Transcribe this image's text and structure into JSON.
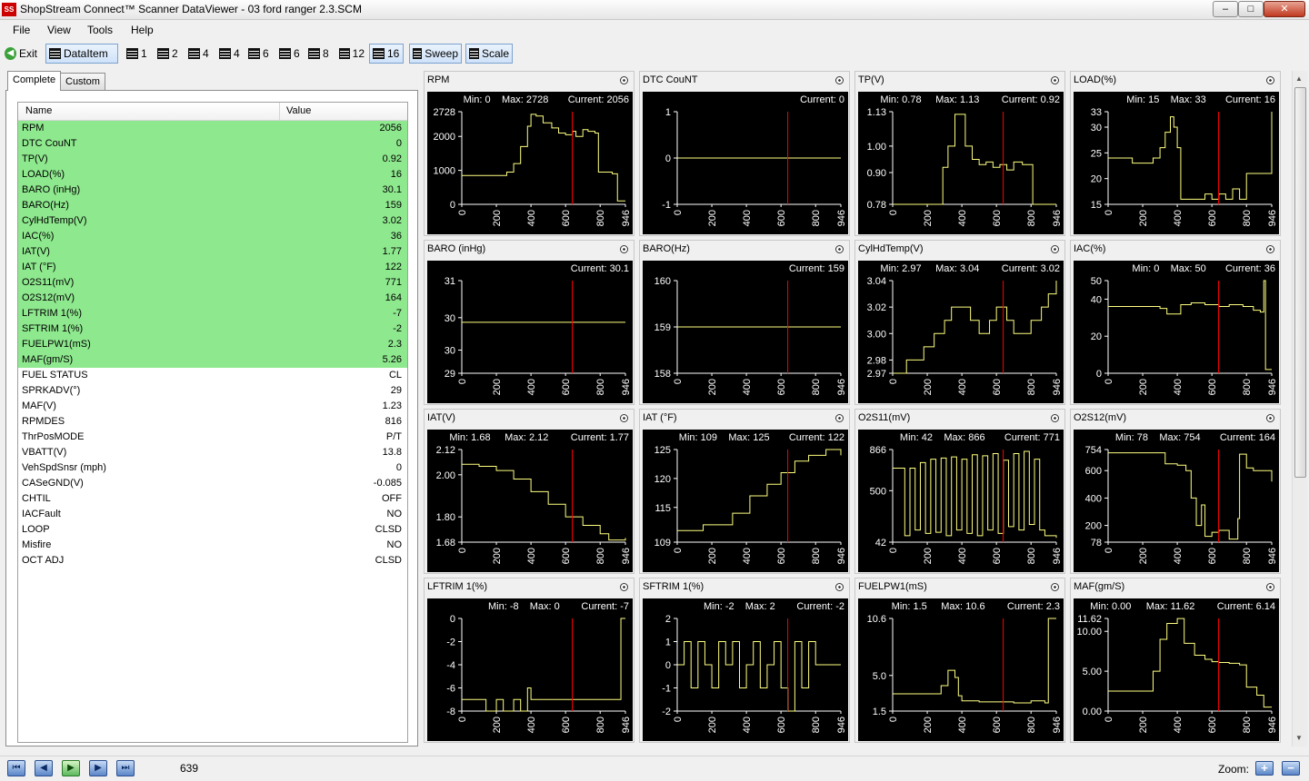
{
  "window": {
    "title": "ShopStream Connect™ Scanner DataViewer - 03 ford ranger 2.3.SCM",
    "icon_text": "SS",
    "minimize": "–",
    "maximize": "□",
    "close": "✕"
  },
  "menu": [
    "File",
    "View",
    "Tools",
    "Help"
  ],
  "toolbar": [
    {
      "id": "exit",
      "label": "Exit"
    },
    {
      "id": "dataitem",
      "label": "DataItem",
      "pressed": true
    },
    {
      "id": "layout-1",
      "label": "1"
    },
    {
      "id": "layout-2",
      "label": "2"
    },
    {
      "id": "layout-4a",
      "label": "4"
    },
    {
      "id": "layout-4b",
      "label": "4"
    },
    {
      "id": "layout-6a",
      "label": "6"
    },
    {
      "id": "layout-6b",
      "label": "6"
    },
    {
      "id": "layout-8",
      "label": "8"
    },
    {
      "id": "layout-12",
      "label": "12"
    },
    {
      "id": "layout-16",
      "label": "16",
      "pressed": true
    },
    {
      "id": "sweep",
      "label": "Sweep",
      "pressed": true
    },
    {
      "id": "scale",
      "label": "Scale",
      "pressed": true
    }
  ],
  "tabs": [
    "Complete",
    "Custom"
  ],
  "grid": {
    "headers": [
      "Name",
      "Value"
    ],
    "rows": [
      {
        "name": "RPM",
        "value": "2056",
        "hi": true
      },
      {
        "name": "DTC CouNT",
        "value": "0",
        "hi": true
      },
      {
        "name": "TP(V)",
        "value": "0.92",
        "hi": true
      },
      {
        "name": "LOAD(%)",
        "value": "16",
        "hi": true
      },
      {
        "name": "BARO (inHg)",
        "value": "30.1",
        "hi": true
      },
      {
        "name": "BARO(Hz)",
        "value": "159",
        "hi": true
      },
      {
        "name": "CylHdTemp(V)",
        "value": "3.02",
        "hi": true
      },
      {
        "name": "IAC(%)",
        "value": "36",
        "hi": true
      },
      {
        "name": "IAT(V)",
        "value": "1.77",
        "hi": true
      },
      {
        "name": "IAT (°F)",
        "value": "122",
        "hi": true
      },
      {
        "name": "O2S11(mV)",
        "value": "771",
        "hi": true
      },
      {
        "name": "O2S12(mV)",
        "value": "164",
        "hi": true
      },
      {
        "name": "LFTRIM 1(%)",
        "value": "-7",
        "hi": true
      },
      {
        "name": "SFTRIM 1(%)",
        "value": "-2",
        "hi": true
      },
      {
        "name": "FUELPW1(mS)",
        "value": "2.3",
        "hi": true
      },
      {
        "name": "MAF(gm/S)",
        "value": "5.26",
        "hi": true
      },
      {
        "name": "FUEL STATUS",
        "value": "CL",
        "hi": false
      },
      {
        "name": "SPRKADV(°)",
        "value": "29",
        "hi": false
      },
      {
        "name": "MAF(V)",
        "value": "1.23",
        "hi": false
      },
      {
        "name": "RPMDES",
        "value": "816",
        "hi": false
      },
      {
        "name": "ThrPosMODE",
        "value": "P/T",
        "hi": false
      },
      {
        "name": "VBATT(V)",
        "value": "13.8",
        "hi": false
      },
      {
        "name": "VehSpdSnsr (mph)",
        "value": "0",
        "hi": false
      },
      {
        "name": "CASeGND(V)",
        "value": "-0.085",
        "hi": false
      },
      {
        "name": "CHTIL",
        "value": "OFF",
        "hi": false
      },
      {
        "name": "IACFault",
        "value": "NO",
        "hi": false
      },
      {
        "name": "LOOP",
        "value": "CLSD",
        "hi": false
      },
      {
        "name": "Misfire",
        "value": "NO",
        "hi": false
      },
      {
        "name": "OCT ADJ",
        "value": "CLSD",
        "hi": false
      }
    ]
  },
  "status": {
    "position": "639",
    "zoom_label": "Zoom:",
    "nav": [
      "⏮",
      "◀",
      "▶",
      "▶",
      "⏭"
    ],
    "zoom_in": "+",
    "zoom_out": "−"
  },
  "chart_colors": {
    "bg": "#000000",
    "line": "#ffff80",
    "cursor": "#ff0000",
    "axis": "#ffffff"
  },
  "chart_data": [
    {
      "type": "line",
      "title": "RPM",
      "min": "0",
      "max": "2728",
      "current": "2056",
      "ylim": [
        0,
        2728
      ],
      "yticks": [
        "2728",
        "2000",
        "1000",
        "0"
      ],
      "ytickvals": [
        2728,
        2000,
        1000,
        0
      ],
      "xticks": [
        "0",
        "200",
        "400",
        "600",
        "800",
        "946"
      ],
      "xlim": [
        0,
        946
      ],
      "cursor": 639,
      "x": [
        0,
        250,
        260,
        300,
        340,
        380,
        400,
        430,
        470,
        520,
        560,
        600,
        640,
        660,
        700,
        730,
        770,
        790,
        840,
        870,
        900,
        946
      ],
      "y": [
        850,
        850,
        950,
        1200,
        1700,
        2300,
        2650,
        2600,
        2400,
        2250,
        2100,
        2050,
        2150,
        2000,
        2200,
        2150,
        2100,
        950,
        950,
        900,
        100,
        100
      ]
    },
    {
      "type": "line",
      "title": "DTC CouNT",
      "current": "0",
      "ylim": [
        -1,
        1
      ],
      "yticks": [
        "1",
        "0",
        "-1"
      ],
      "ytickvals": [
        1,
        0,
        -1
      ],
      "xticks": [
        "0",
        "200",
        "400",
        "600",
        "800",
        "946"
      ],
      "xlim": [
        0,
        946
      ],
      "cursor": 639,
      "x": [
        0,
        946
      ],
      "y": [
        0,
        0
      ]
    },
    {
      "type": "line",
      "title": "TP(V)",
      "min": "0.78",
      "max": "1.13",
      "current": "0.92",
      "ylim": [
        0.78,
        1.13
      ],
      "yticks": [
        "1.13",
        "1.00",
        "0.90",
        "0.78"
      ],
      "ytickvals": [
        1.13,
        1.0,
        0.9,
        0.78
      ],
      "xticks": [
        "0",
        "200",
        "400",
        "600",
        "800",
        "946"
      ],
      "xlim": [
        0,
        946
      ],
      "cursor": 639,
      "x": [
        0,
        270,
        290,
        320,
        360,
        420,
        460,
        500,
        540,
        580,
        620,
        660,
        700,
        750,
        800,
        810,
        946
      ],
      "y": [
        0.78,
        0.78,
        0.92,
        1.0,
        1.12,
        1.0,
        0.95,
        0.93,
        0.94,
        0.92,
        0.93,
        0.91,
        0.94,
        0.93,
        0.93,
        0.78,
        0.78
      ]
    },
    {
      "type": "line",
      "title": "LOAD(%)",
      "min": "15",
      "max": "33",
      "current": "16",
      "ylim": [
        15,
        33
      ],
      "yticks": [
        "33",
        "30",
        "25",
        "20",
        "15"
      ],
      "ytickvals": [
        33,
        30,
        25,
        20,
        15
      ],
      "xticks": [
        "0",
        "200",
        "400",
        "600",
        "800",
        "946"
      ],
      "xlim": [
        0,
        946
      ],
      "cursor": 639,
      "x": [
        0,
        100,
        140,
        220,
        260,
        300,
        330,
        360,
        380,
        400,
        420,
        500,
        560,
        600,
        640,
        680,
        720,
        760,
        800,
        880,
        946
      ],
      "y": [
        24,
        24,
        23,
        23,
        24,
        26,
        29,
        32,
        30,
        26,
        16,
        16,
        17,
        16,
        17,
        16,
        18,
        16,
        21,
        21,
        33
      ]
    },
    {
      "type": "line",
      "title": "BARO (inHg)",
      "current": "30.1",
      "ylim": [
        29,
        31
      ],
      "yticks": [
        "31",
        "30",
        "30",
        "29"
      ],
      "ytickvals": [
        31,
        30.2,
        29.5,
        29
      ],
      "xticks": [
        "0",
        "200",
        "400",
        "600",
        "800",
        "946"
      ],
      "xlim": [
        0,
        946
      ],
      "cursor": 639,
      "x": [
        0,
        946
      ],
      "y": [
        30.1,
        30.1
      ]
    },
    {
      "type": "line",
      "title": "BARO(Hz)",
      "current": "159",
      "ylim": [
        158,
        160
      ],
      "yticks": [
        "160",
        "159",
        "158"
      ],
      "ytickvals": [
        160,
        159,
        158
      ],
      "xticks": [
        "0",
        "200",
        "400",
        "600",
        "800",
        "946"
      ],
      "xlim": [
        0,
        946
      ],
      "cursor": 639,
      "x": [
        0,
        946
      ],
      "y": [
        159,
        159
      ]
    },
    {
      "type": "line",
      "title": "CylHdTemp(V)",
      "min": "2.97",
      "max": "3.04",
      "current": "3.02",
      "ylim": [
        2.97,
        3.04
      ],
      "yticks": [
        "3.04",
        "3.02",
        "3.00",
        "2.98",
        "2.97"
      ],
      "ytickvals": [
        3.04,
        3.02,
        3.0,
        2.98,
        2.97
      ],
      "xticks": [
        "0",
        "200",
        "400",
        "600",
        "800",
        "946"
      ],
      "xlim": [
        0,
        946
      ],
      "cursor": 639,
      "x": [
        0,
        80,
        180,
        240,
        300,
        340,
        400,
        450,
        500,
        560,
        600,
        660,
        700,
        760,
        800,
        860,
        900,
        946
      ],
      "y": [
        2.97,
        2.98,
        2.99,
        3.0,
        3.01,
        3.02,
        3.02,
        3.01,
        3.0,
        3.01,
        3.02,
        3.01,
        3.0,
        3.0,
        3.01,
        3.02,
        3.03,
        3.04
      ]
    },
    {
      "type": "line",
      "title": "IAC(%)",
      "min": "0",
      "max": "50",
      "current": "36",
      "ylim": [
        0,
        50
      ],
      "yticks": [
        "50",
        "40",
        "20",
        "0"
      ],
      "ytickvals": [
        50,
        40,
        20,
        0
      ],
      "xticks": [
        "0",
        "200",
        "400",
        "600",
        "800",
        "946"
      ],
      "xlim": [
        0,
        946
      ],
      "cursor": 639,
      "x": [
        0,
        200,
        300,
        340,
        420,
        480,
        560,
        640,
        700,
        780,
        840,
        880,
        900,
        910,
        946
      ],
      "y": [
        36,
        36,
        35,
        32,
        37,
        38,
        37,
        36,
        37,
        36,
        34,
        33,
        50,
        2,
        2
      ]
    },
    {
      "type": "line",
      "title": "IAT(V)",
      "min": "1.68",
      "max": "2.12",
      "current": "1.77",
      "ylim": [
        1.68,
        2.12
      ],
      "yticks": [
        "2.12",
        "2.00",
        "1.80",
        "1.68"
      ],
      "ytickvals": [
        2.12,
        2.0,
        1.8,
        1.68
      ],
      "xticks": [
        "0",
        "200",
        "400",
        "600",
        "800",
        "946"
      ],
      "xlim": [
        0,
        946
      ],
      "cursor": 639,
      "x": [
        0,
        100,
        200,
        300,
        400,
        500,
        600,
        700,
        800,
        850,
        946
      ],
      "y": [
        2.05,
        2.04,
        2.02,
        1.98,
        1.92,
        1.86,
        1.8,
        1.76,
        1.72,
        1.69,
        1.7
      ]
    },
    {
      "type": "line",
      "title": "IAT (°F)",
      "min": "109",
      "max": "125",
      "current": "122",
      "ylim": [
        109,
        125
      ],
      "yticks": [
        "125",
        "120",
        "115",
        "109"
      ],
      "ytickvals": [
        125,
        120,
        115,
        109
      ],
      "xticks": [
        "0",
        "200",
        "400",
        "600",
        "800",
        "946"
      ],
      "xlim": [
        0,
        946
      ],
      "cursor": 639,
      "x": [
        0,
        150,
        320,
        420,
        520,
        600,
        680,
        760,
        860,
        946
      ],
      "y": [
        111,
        112,
        114,
        117,
        119,
        121,
        123,
        124,
        125,
        124
      ]
    },
    {
      "type": "line",
      "title": "O2S11(mV)",
      "min": "42",
      "max": "866",
      "current": "771",
      "ylim": [
        42,
        866
      ],
      "yticks": [
        "866",
        "500",
        "42"
      ],
      "ytickvals": [
        866,
        500,
        42
      ],
      "xticks": [
        "0",
        "200",
        "400",
        "600",
        "800",
        "946"
      ],
      "xlim": [
        0,
        946
      ],
      "cursor": 639,
      "x": [
        0,
        50,
        70,
        100,
        130,
        160,
        190,
        220,
        250,
        280,
        310,
        340,
        370,
        400,
        430,
        460,
        490,
        520,
        550,
        580,
        610,
        640,
        670,
        700,
        730,
        760,
        790,
        820,
        850,
        880,
        946
      ],
      "y": [
        700,
        700,
        100,
        700,
        150,
        750,
        120,
        780,
        130,
        790,
        100,
        800,
        150,
        780,
        120,
        820,
        100,
        810,
        150,
        830,
        120,
        771,
        180,
        830,
        150,
        850,
        200,
        780,
        150,
        100,
        80
      ]
    },
    {
      "type": "line",
      "title": "O2S12(mV)",
      "min": "78",
      "max": "754",
      "current": "164",
      "ylim": [
        78,
        754
      ],
      "yticks": [
        "754",
        "600",
        "400",
        "200",
        "78"
      ],
      "ytickvals": [
        754,
        600,
        400,
        200,
        78
      ],
      "xticks": [
        "0",
        "200",
        "400",
        "600",
        "800",
        "946"
      ],
      "xlim": [
        0,
        946
      ],
      "cursor": 639,
      "x": [
        0,
        300,
        330,
        400,
        450,
        480,
        510,
        540,
        560,
        600,
        640,
        700,
        750,
        760,
        800,
        840,
        946
      ],
      "y": [
        730,
        730,
        650,
        640,
        600,
        400,
        200,
        350,
        120,
        150,
        164,
        100,
        250,
        720,
        620,
        600,
        520
      ]
    },
    {
      "type": "line",
      "title": "LFTRIM 1(%)",
      "min": "-8",
      "max": "0",
      "current": "-7",
      "ylim": [
        -8,
        0
      ],
      "yticks": [
        "0",
        "-2",
        "-4",
        "-6",
        "-8"
      ],
      "ytickvals": [
        0,
        -2,
        -4,
        -6,
        -8
      ],
      "xticks": [
        "0",
        "200",
        "400",
        "600",
        "800",
        "946"
      ],
      "xlim": [
        0,
        946
      ],
      "cursor": 639,
      "x": [
        0,
        100,
        140,
        200,
        240,
        300,
        340,
        380,
        400,
        600,
        800,
        900,
        920,
        946
      ],
      "y": [
        -7,
        -7,
        -8,
        -7,
        -8,
        -7,
        -8,
        -6,
        -7,
        -7,
        -7,
        -7,
        0,
        0
      ]
    },
    {
      "type": "line",
      "title": "SFTRIM 1(%)",
      "min": "-2",
      "max": "2",
      "current": "-2",
      "ylim": [
        -2,
        2
      ],
      "yticks": [
        "2",
        "1",
        "0",
        "-1",
        "-2"
      ],
      "ytickvals": [
        2,
        1,
        0,
        -1,
        -2
      ],
      "xticks": [
        "0",
        "200",
        "400",
        "600",
        "800",
        "946"
      ],
      "xlim": [
        0,
        946
      ],
      "cursor": 639,
      "x": [
        0,
        40,
        80,
        120,
        160,
        200,
        240,
        280,
        320,
        360,
        400,
        440,
        480,
        520,
        560,
        600,
        640,
        680,
        720,
        760,
        800,
        840,
        946
      ],
      "y": [
        0,
        1,
        -1,
        1,
        0,
        -1,
        1,
        0,
        1,
        -1,
        0,
        1,
        -1,
        0,
        1,
        -1,
        -2,
        1,
        -1,
        1,
        0,
        0,
        0
      ]
    },
    {
      "type": "line",
      "title": "FUELPW1(mS)",
      "min": "1.5",
      "max": "10.6",
      "current": "2.3",
      "ylim": [
        1.5,
        10.6
      ],
      "yticks": [
        "10.6",
        "5.0",
        "1.5"
      ],
      "ytickvals": [
        10.6,
        5.0,
        1.5
      ],
      "xticks": [
        "0",
        "200",
        "400",
        "600",
        "800",
        "946"
      ],
      "xlim": [
        0,
        946
      ],
      "cursor": 639,
      "x": [
        0,
        200,
        280,
        320,
        360,
        380,
        400,
        500,
        600,
        700,
        800,
        880,
        900,
        946
      ],
      "y": [
        3.2,
        3.2,
        4.0,
        5.5,
        4.8,
        3.0,
        2.5,
        2.4,
        2.4,
        2.3,
        2.5,
        2.3,
        10.6,
        10.6
      ]
    },
    {
      "type": "line",
      "title": "MAF(gm/S)",
      "min": "0.00",
      "max": "11.62",
      "current": "6.14",
      "ylim": [
        0,
        11.62
      ],
      "yticks": [
        "11.62",
        "10.00",
        "5.00",
        "0.00"
      ],
      "ytickvals": [
        11.62,
        10.0,
        5.0,
        0.0
      ],
      "xticks": [
        "0",
        "200",
        "400",
        "600",
        "800",
        "946"
      ],
      "xlim": [
        0,
        946
      ],
      "cursor": 639,
      "x": [
        0,
        200,
        260,
        300,
        340,
        400,
        440,
        500,
        560,
        600,
        640,
        700,
        760,
        800,
        860,
        900,
        946
      ],
      "y": [
        2.5,
        2.5,
        5.0,
        9.0,
        11.0,
        11.6,
        8.5,
        7.0,
        6.5,
        6.2,
        6.1,
        6.0,
        5.8,
        3.0,
        2.0,
        0.5,
        0.5
      ]
    }
  ]
}
